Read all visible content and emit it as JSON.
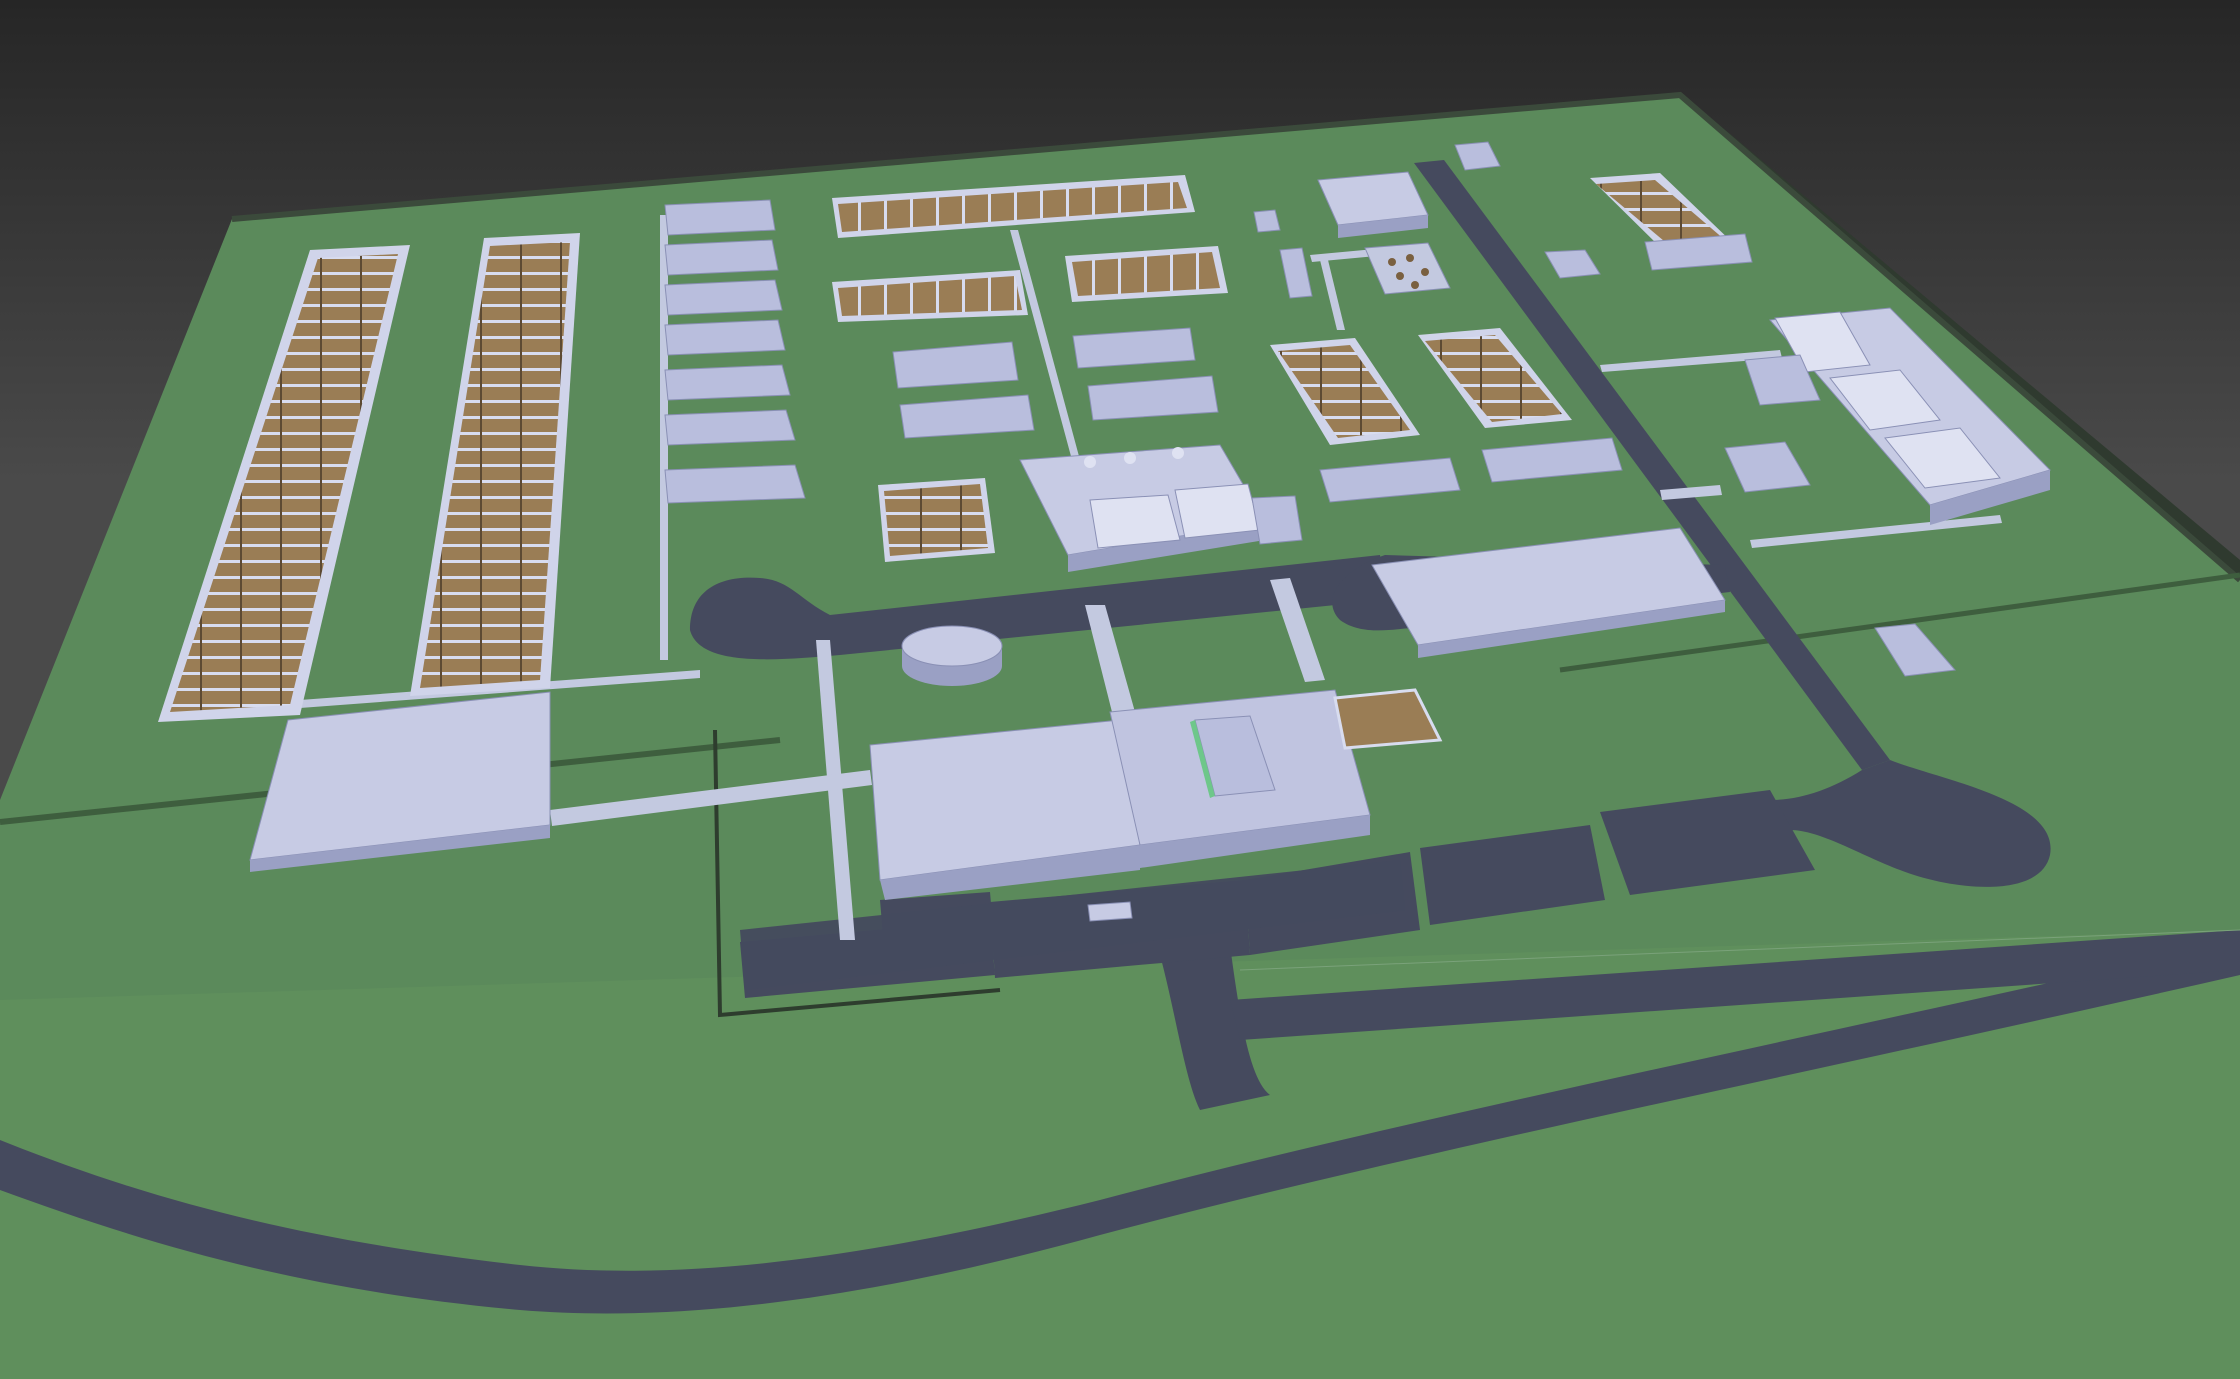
{
  "scene": {
    "view": "3d-site-model",
    "colors": {
      "background_top": "#262626",
      "background_bottom": "#4a4a4a",
      "ground": "#5b8a5b",
      "ground_edge": "#3a4a3a",
      "road": "#454a5e",
      "path": "#c3c9e0",
      "building_roof": "#b9bedd",
      "building_wall": "#9aa0c4",
      "pen_floor": "#9a7d55",
      "pen_divider": "#d8dcef",
      "tank": "#b2b7d6",
      "accent_green": "#6ec78a"
    }
  }
}
